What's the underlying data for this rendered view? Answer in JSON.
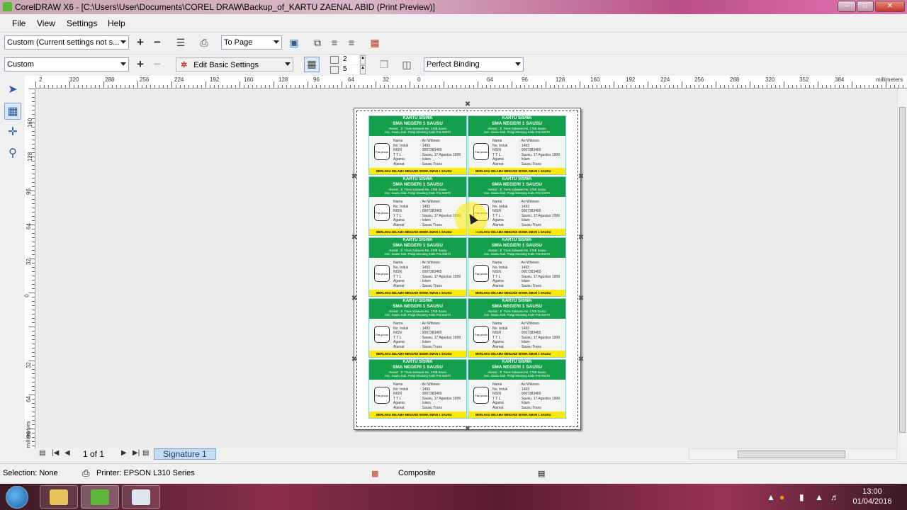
{
  "window": {
    "title": "CorelDRAW X6 - [C:\\Users\\User\\Documents\\COREL DRAW\\Backup_of_KARTU  ZAENAL ABID (Print Preview)]"
  },
  "menu": [
    "File",
    "View",
    "Settings",
    "Help"
  ],
  "toolbar1": {
    "print_style": "Custom (Current settings not s...",
    "fit_mode": "To Page"
  },
  "toolbar2": {
    "imposition": "Custom",
    "edit_settings": "Edit Basic Settings",
    "columns": "2",
    "rows": "5",
    "binding": "Perfect Binding"
  },
  "ruler": {
    "h_labels": [
      "2",
      "320",
      "288",
      "256",
      "224",
      "192",
      "160",
      "128",
      "96",
      "64",
      "32",
      "0",
      "64",
      "96",
      "128",
      "160",
      "192",
      "224",
      "256",
      "288",
      "320",
      "352",
      "384"
    ],
    "h_unit": "millimeters",
    "v_labels": [
      "160",
      "128",
      "96",
      "64",
      "32",
      "0",
      "32",
      "64",
      "96"
    ],
    "v_unit": "millimeters"
  },
  "card": {
    "title": "KARTU SISWA",
    "school": "SMA NEGERI 1 SAUSU",
    "address1": "Alamat : Jl. Trans Sulawesi No. 176B Sausu",
    "address2": "Kec. Sausu Kab. Parigi Moutong Kode Pos 94373",
    "photo": "Pas photo 3x4",
    "labels": [
      "Nama",
      "No. Induk",
      "NISN",
      "T T L",
      "Agama",
      "Alamat"
    ],
    "values": [
      ": Ari Wibowo",
      ": 1493",
      ": 0007383465",
      ": Sausu, 17 Agustus 1999",
      ": Islam",
      ": Sausu Trans"
    ],
    "footer": "BERLAKU SELAMA MENJADI SISWA SMAN 1 SAUSU"
  },
  "pagenav": {
    "page_of": "1 of 1",
    "tab": "Signature 1"
  },
  "status": {
    "selection": "Selection: None",
    "printer": "Printer: EPSON L310 Series",
    "composite": "Composite"
  },
  "taskbar": {
    "time": "13:00",
    "date": "01/04/2016"
  },
  "colors": {
    "card_band": "#14a04a",
    "card_footer": "#ffea00",
    "signature_tab": "#c3dcf4"
  }
}
